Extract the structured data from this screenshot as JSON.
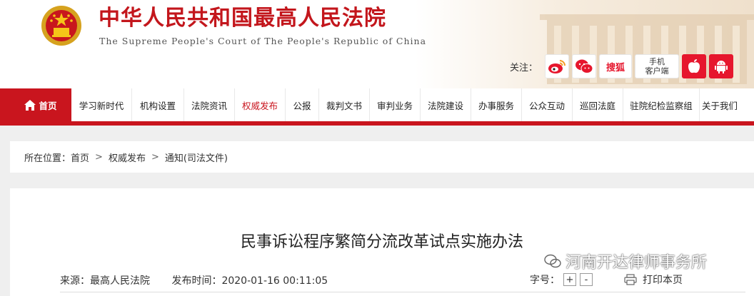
{
  "header": {
    "title": "中华人民共和国最高人民法院",
    "subtitle": "The Supreme People's Court of The People's Republic of China",
    "follow_label": "关注：",
    "social": [
      {
        "name": "weibo-icon"
      },
      {
        "name": "wechat-icon"
      },
      {
        "name": "sohu-icon",
        "label": "搜狐"
      }
    ],
    "app_label_1": "手机",
    "app_label_2": "客户端",
    "apps": [
      {
        "name": "apple-icon"
      },
      {
        "name": "android-icon"
      }
    ]
  },
  "nav": {
    "home": "首页",
    "items": [
      "学习新时代",
      "机构设置",
      "法院资讯",
      "权威发布",
      "公报",
      "裁判文书",
      "审判业务",
      "法院建设",
      "办事服务",
      "公众互动",
      "巡回法庭",
      "驻院纪检监察组",
      "关于我们"
    ],
    "active": "权威发布"
  },
  "breadcrumb": {
    "prefix": "所在位置：",
    "items": [
      "首页",
      "权威发布",
      "通知(司法文件)"
    ]
  },
  "article": {
    "title": "民事诉讼程序繁简分流改革试点实施办法",
    "source_label": "来源：",
    "source": "最高人民法院",
    "time_label": "发布时间：",
    "time": "2020-01-16 00:11:05",
    "font_label": "字号：",
    "font_increase": "+",
    "font_decrease": "-",
    "print_label": "打印本页"
  },
  "watermark": "河南开达律师事务所",
  "colors": {
    "brand_red": "#c9151e",
    "title_red": "#c3161c"
  }
}
